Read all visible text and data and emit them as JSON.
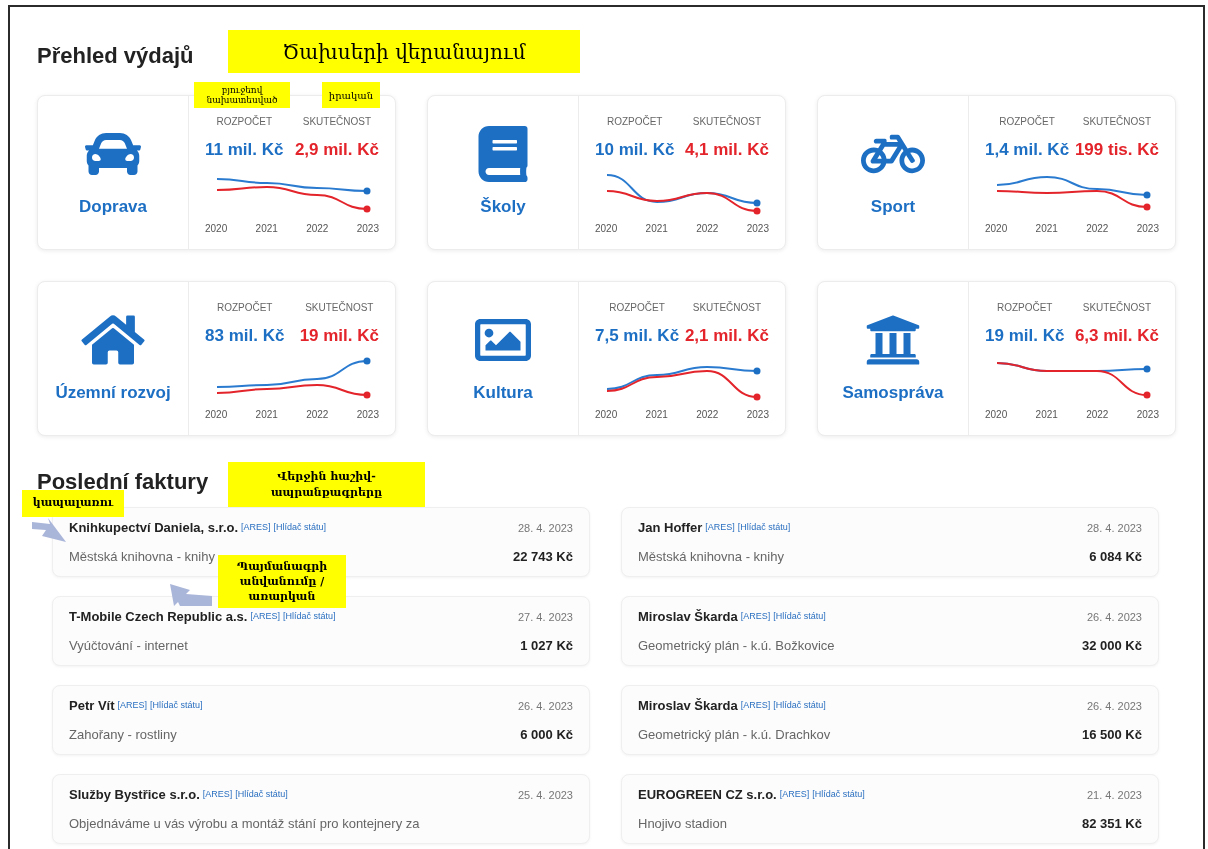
{
  "expenses": {
    "title": "Přehled výdajů",
    "categories": [
      {
        "name": "Doprava",
        "budget_label": "ROZPOČET",
        "budget": "11 mil. Kč",
        "actual_label": "SKUTEČNOST",
        "actual": "2,9 mil. Kč",
        "years": [
          "2020",
          "2021",
          "2022",
          "2023"
        ]
      },
      {
        "name": "Školy",
        "budget_label": "ROZPOČET",
        "budget": "10 mil. Kč",
        "actual_label": "SKUTEČNOST",
        "actual": "4,1 mil. Kč",
        "years": [
          "2020",
          "2021",
          "2022",
          "2023"
        ]
      },
      {
        "name": "Sport",
        "budget_label": "ROZPOČET",
        "budget": "1,4 mil. Kč",
        "actual_label": "SKUTEČNOST",
        "actual": "199 tis. Kč",
        "years": [
          "2020",
          "2021",
          "2022",
          "2023"
        ]
      },
      {
        "name": "Územní rozvoj",
        "budget_label": "ROZPOČET",
        "budget": "83 mil. Kč",
        "actual_label": "SKUTEČNOST",
        "actual": "19 mil. Kč",
        "years": [
          "2020",
          "2021",
          "2022",
          "2023"
        ]
      },
      {
        "name": "Kultura",
        "budget_label": "ROZPOČET",
        "budget": "7,5 mil. Kč",
        "actual_label": "SKUTEČNOST",
        "actual": "2,1 mil. Kč",
        "years": [
          "2020",
          "2021",
          "2022",
          "2023"
        ]
      },
      {
        "name": "Samospráva",
        "budget_label": "ROZPOČET",
        "budget": "19 mil. Kč",
        "actual_label": "SKUTEČNOST",
        "actual": "6,3 mil. Kč",
        "years": [
          "2020",
          "2021",
          "2022",
          "2023"
        ]
      }
    ]
  },
  "invoices": {
    "title": "Poslední faktury",
    "items": [
      {
        "supplier": "Knihkupectví Daniela, s.r.o.",
        "links": [
          "[ARES]",
          "[Hlídač státu]"
        ],
        "date": "28. 4. 2023",
        "subject": "Městská knihovna - knihy",
        "amount": "22 743 Kč"
      },
      {
        "supplier": "Jan Hoffer",
        "links": [
          "[ARES]",
          "[Hlídač státu]"
        ],
        "date": "28. 4. 2023",
        "subject": "Městská knihovna - knihy",
        "amount": "6 084 Kč"
      },
      {
        "supplier": "T-Mobile Czech Republic a.s.",
        "links": [
          "[ARES]",
          "[Hlídač státu]"
        ],
        "date": "27. 4. 2023",
        "subject": "Vyúčtování - internet",
        "amount": "1 027 Kč"
      },
      {
        "supplier": "Miroslav Škarda",
        "links": [
          "[ARES]",
          "[Hlídač státu]"
        ],
        "date": "26. 4. 2023",
        "subject": "Geometrický plán - k.ú. Božkovice",
        "amount": "32 000 Kč"
      },
      {
        "supplier": "Petr Vít",
        "links": [
          "[ARES]",
          "[Hlídač státu]"
        ],
        "date": "26. 4. 2023",
        "subject": "Zahořany - rostliny",
        "amount": "6 000 Kč"
      },
      {
        "supplier": "Miroslav Škarda",
        "links": [
          "[ARES]",
          "[Hlídač státu]"
        ],
        "date": "26. 4. 2023",
        "subject": "Geometrický plán - k.ú. Drachkov",
        "amount": "16 500 Kč"
      },
      {
        "supplier": "Služby Bystřice s.r.o.",
        "links": [
          "[ARES]",
          "[Hlídač státu]"
        ],
        "date": "25. 4. 2023",
        "subject": "Objednáváme u vás výrobu a montáž stání pro kontejnery za"
      },
      {
        "supplier": "EUROGREEN CZ s.r.o.",
        "links": [
          "[ARES]",
          "[Hlídač státu]"
        ],
        "date": "21. 4. 2023",
        "subject": "Hnojivo stadion",
        "amount": "82 351 Kč"
      }
    ]
  },
  "annotations": [
    {
      "text": "Ծախսերի վերանայում"
    },
    {
      "text": "բյուջեով նախատեսված"
    },
    {
      "text": "իրական"
    },
    {
      "text": "Վերջին հաշիվ-ապրանքագրերը"
    },
    {
      "text": "կապալառու"
    },
    {
      "text": "Պայմանագրի անվանումը / առարկան"
    }
  ]
}
